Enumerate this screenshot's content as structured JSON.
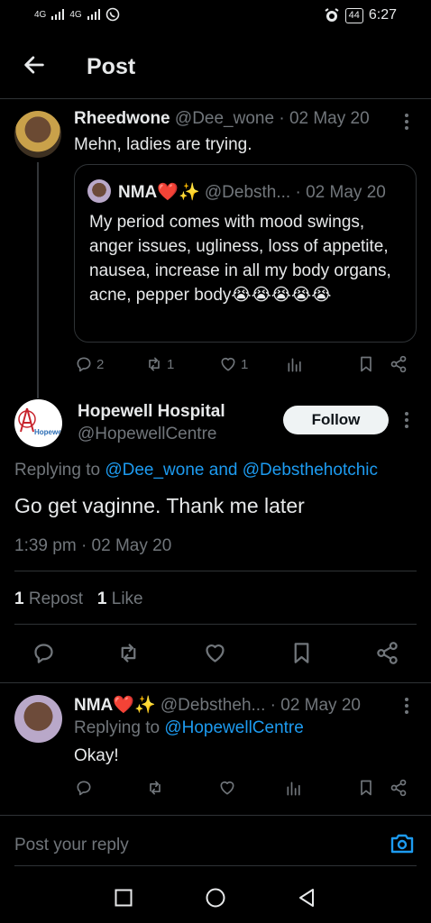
{
  "status_bar": {
    "network_left": "4G",
    "network_right": "4G",
    "battery": "44",
    "time": "6:27"
  },
  "header": {
    "title": "Post"
  },
  "quoted_parent": {
    "author_name": "Rheedwone",
    "handle": "@Dee_wone",
    "date_sep": "·",
    "date": "02 May 20",
    "text": "Mehn, ladies are trying.",
    "quote": {
      "author_name": "NMA",
      "name_emoji": "❤️✨",
      "handle": "@Debsth...",
      "date_sep": "·",
      "date": "02 May 20",
      "text": "My period comes with mood swings, anger issues, ugliness, loss of appetite, nausea, increase in all my body organs, acne, pepper body😭😭😭😭😭"
    },
    "actions": {
      "replies": "2",
      "reposts": "1",
      "likes": "1"
    }
  },
  "main_post": {
    "author_name": "Hopewell Hospital",
    "handle": "@HopewellCentre",
    "follow_label": "Follow",
    "replying_prefix": "Replying to",
    "replying_to_1": "@Dee_wone",
    "replying_and": "and",
    "replying_to_2": "@Debsthehotchic",
    "text": "Go get vaginne. Thank me later",
    "time": "1:39 pm",
    "date_sep": "·",
    "date": "02 May 20",
    "repost_count": "1",
    "repost_label": "Repost",
    "like_count": "1",
    "like_label": "Like",
    "avatar_text": "Hopewe"
  },
  "reply_post": {
    "author_name": "NMA",
    "name_emoji": "❤️✨",
    "handle": "@Debstheh...",
    "date_sep": "·",
    "date": "02 May 20",
    "replying_prefix": "Replying to",
    "replying_to": "@HopewellCentre",
    "text": "Okay!"
  },
  "reply_bar": {
    "placeholder": "Post your reply"
  },
  "colors": {
    "background": "#000000",
    "text_primary": "#e7e9ea",
    "text_secondary": "#71767b",
    "link": "#1d9bf0",
    "divider": "#2f3336"
  }
}
